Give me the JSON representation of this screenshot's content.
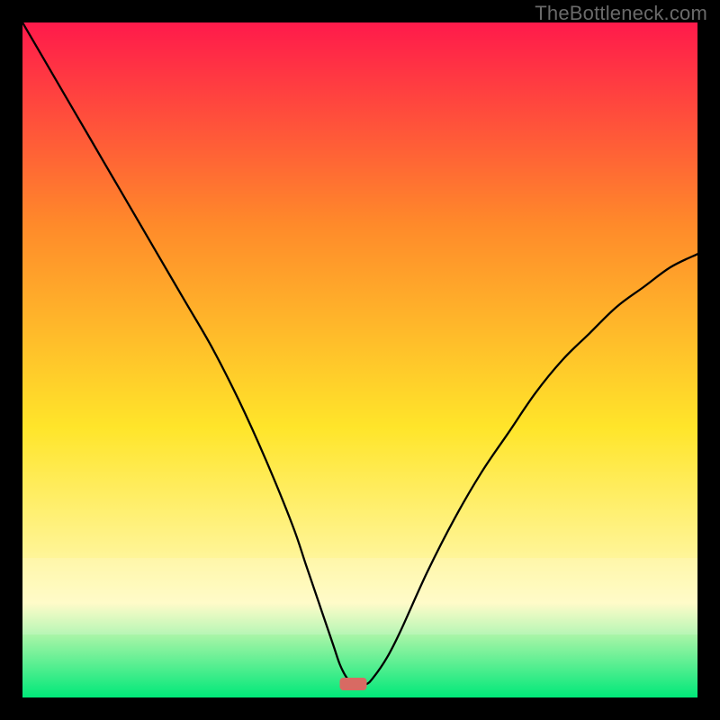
{
  "watermark": "TheBottleneck.com",
  "colors": {
    "bg": "#000000",
    "gradient_top": "#ff1a4b",
    "gradient_upper_mid": "#ff8a2a",
    "gradient_mid": "#ffe52a",
    "gradient_lower_mid": "#fffbbf",
    "gradient_bottom": "#00e879",
    "curve": "#000000",
    "marker": "#d86a63",
    "watermark": "#6a6a6a"
  },
  "chart_data": {
    "type": "line",
    "title": "",
    "xlabel": "",
    "ylabel": "",
    "xlim": [
      0,
      100
    ],
    "ylim": [
      0,
      100
    ],
    "grid": false,
    "legend": false,
    "x": [
      0,
      4,
      8,
      12,
      16,
      20,
      24,
      28,
      32,
      36,
      40,
      42,
      44,
      46,
      47,
      48,
      49,
      50,
      51,
      52,
      54,
      56,
      60,
      64,
      68,
      72,
      76,
      80,
      84,
      88,
      92,
      96,
      100
    ],
    "values": [
      100,
      93,
      86,
      79,
      72,
      65,
      58,
      51,
      43,
      34,
      24,
      18,
      12,
      6,
      3,
      1,
      0,
      0,
      0,
      1,
      4,
      8,
      17,
      25,
      32,
      38,
      44,
      49,
      53,
      57,
      60,
      63,
      65
    ],
    "marker": {
      "x": 49,
      "y": 0,
      "shape": "rounded-rect"
    },
    "annotations": []
  }
}
